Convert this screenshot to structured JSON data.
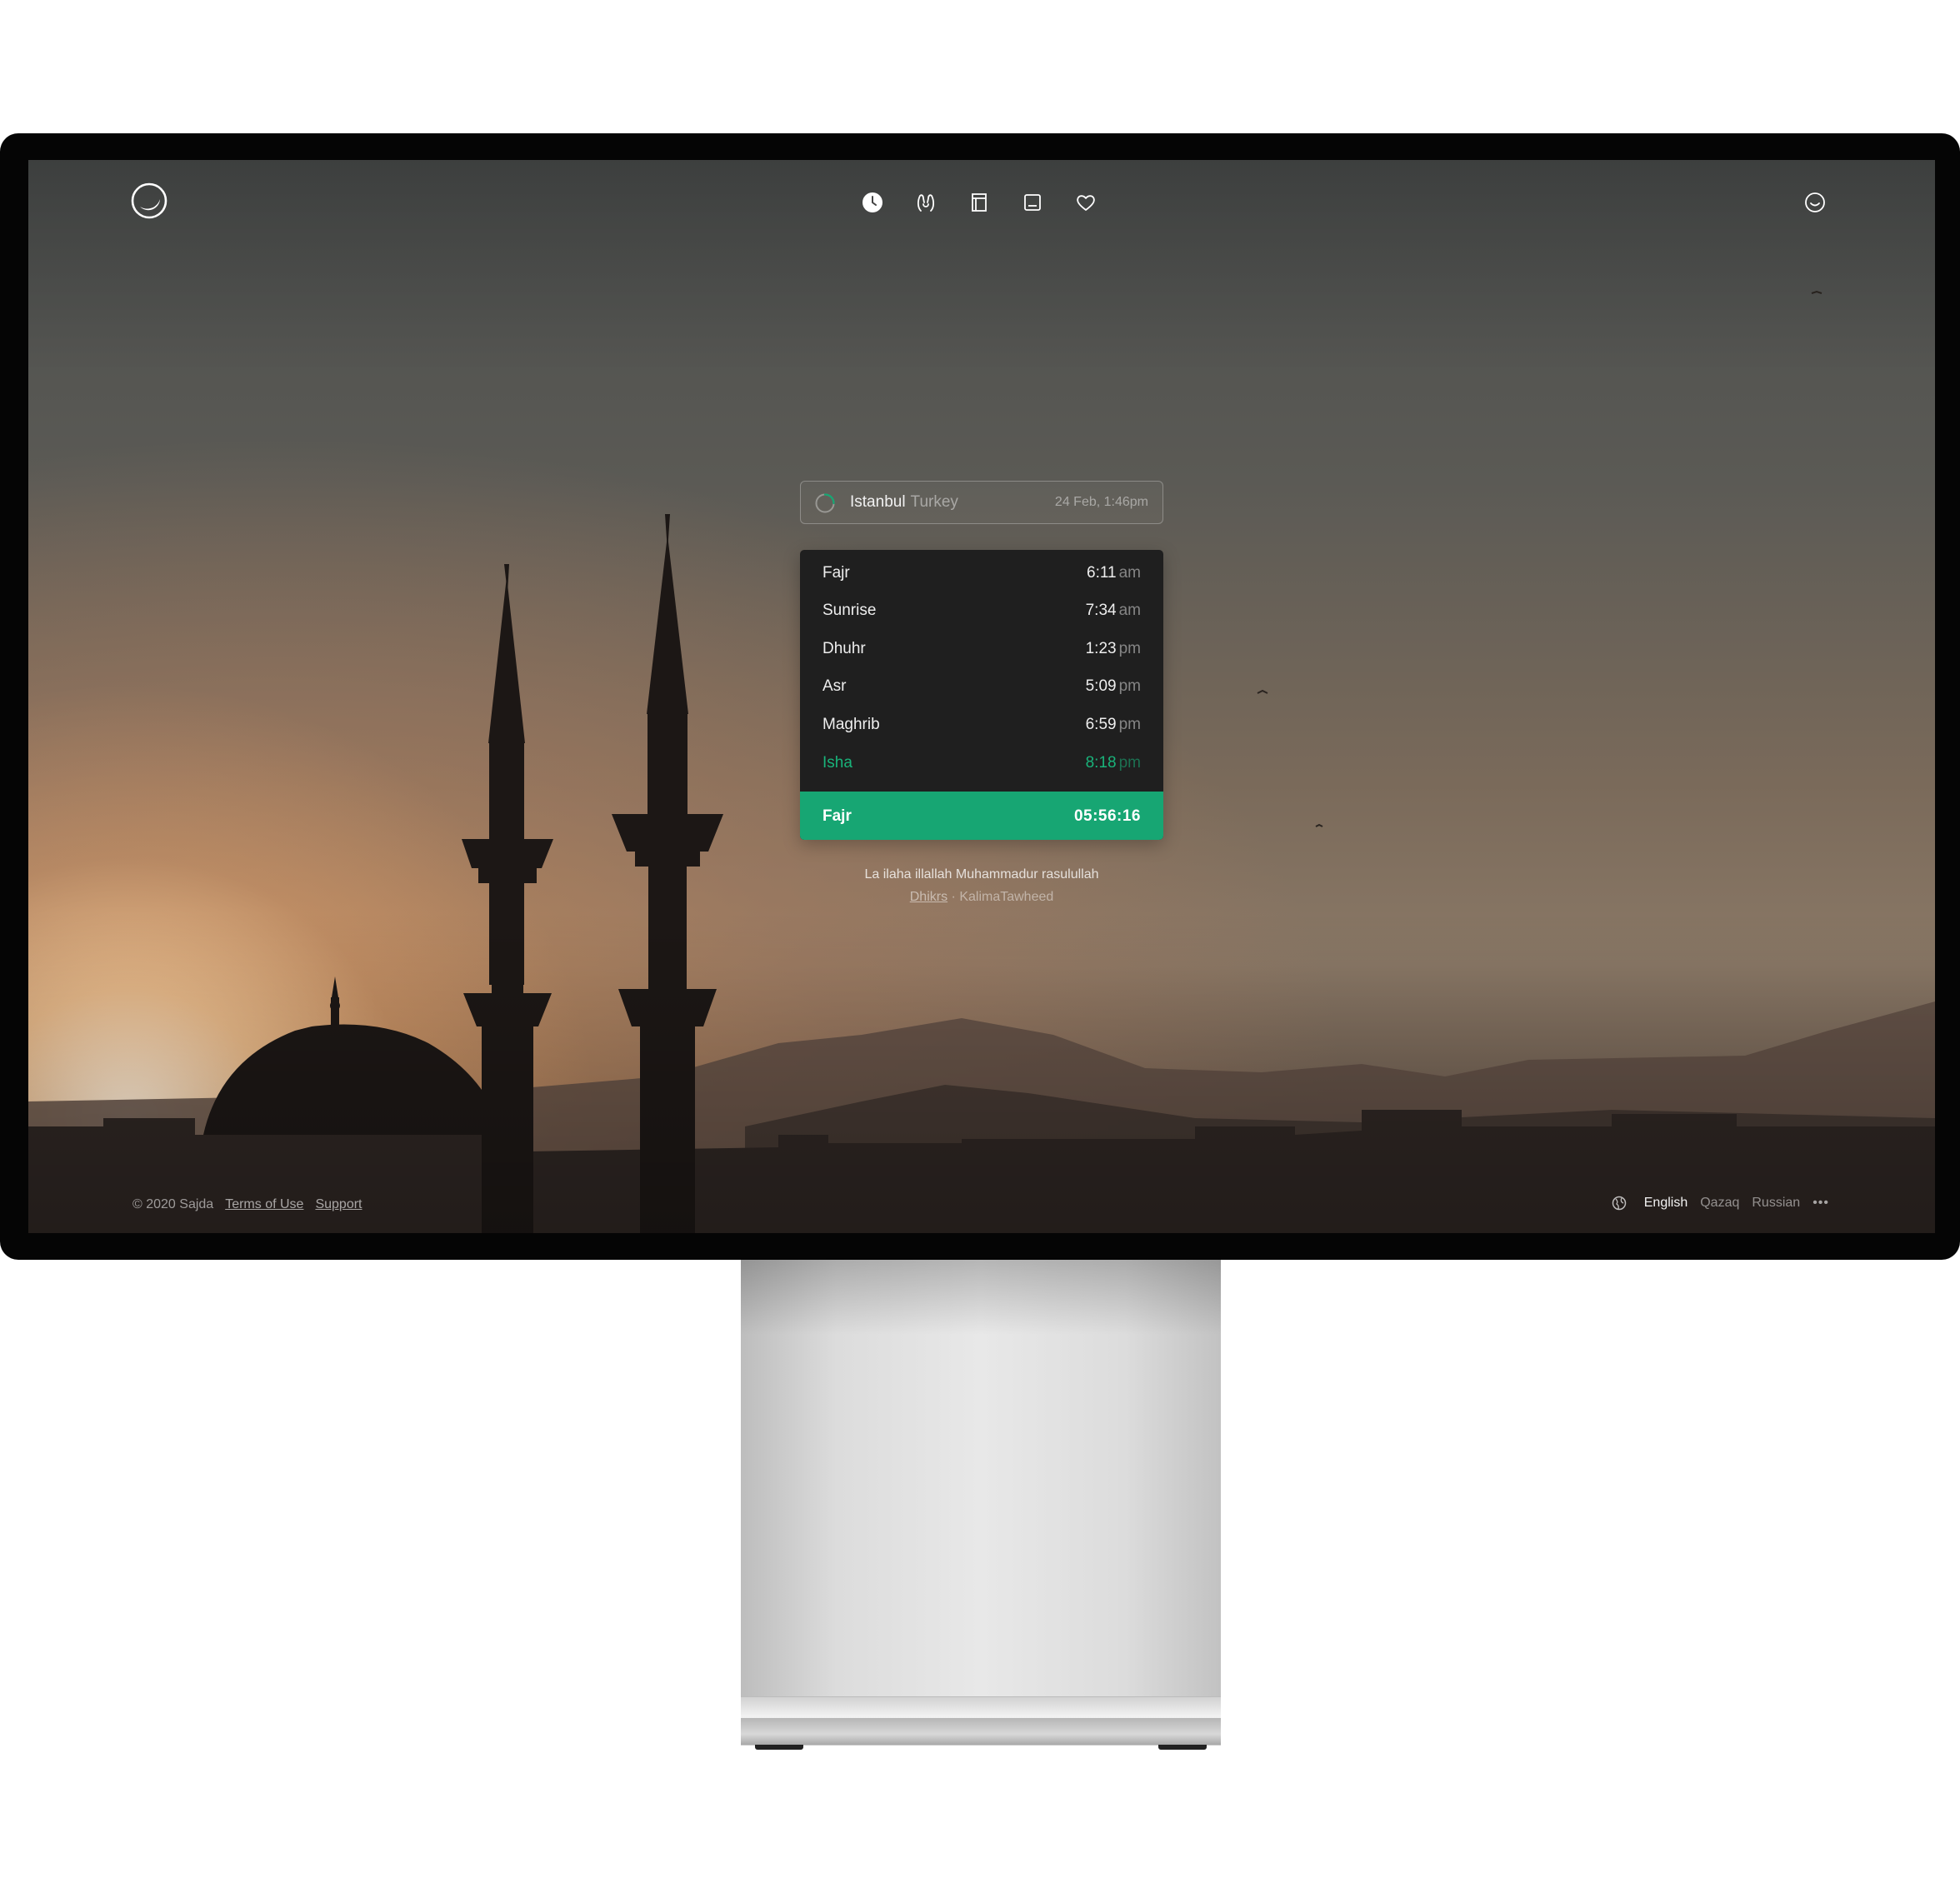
{
  "nav": {
    "items": [
      {
        "icon": "clock-icon",
        "active": true
      },
      {
        "icon": "hands-icon",
        "active": false
      },
      {
        "icon": "book-icon",
        "active": false
      },
      {
        "icon": "calendar-icon",
        "active": false
      },
      {
        "icon": "heart-icon",
        "active": false
      }
    ]
  },
  "location": {
    "city": "Istanbul",
    "country": "Turkey",
    "datetime": "24 Feb, 1:46pm"
  },
  "prayers": [
    {
      "name": "Fajr",
      "time": "6:11",
      "ampm": "am"
    },
    {
      "name": "Sunrise",
      "time": "7:34",
      "ampm": "am"
    },
    {
      "name": "Dhuhr",
      "time": "1:23",
      "ampm": "pm"
    },
    {
      "name": "Asr",
      "time": "5:09",
      "ampm": "pm"
    },
    {
      "name": "Maghrib",
      "time": "6:59",
      "ampm": "pm"
    },
    {
      "name": "Isha",
      "time": "8:18",
      "ampm": "pm"
    }
  ],
  "next_prayer": {
    "name": "Fajr",
    "countdown": "05:56:16"
  },
  "dhikr": {
    "text": "La ilaha illallah Muhammadur rasulullah",
    "category": "Dhikrs",
    "separator": "·",
    "name": "KalimaTawheed"
  },
  "footer": {
    "copyright": "© 2020 Sajda",
    "terms": "Terms of Use",
    "support": "Support",
    "languages": [
      "English",
      "Qazaq",
      "Russian"
    ],
    "more": "•••"
  },
  "colors": {
    "accent": "#17a673",
    "panel": "#1f1f1f"
  }
}
